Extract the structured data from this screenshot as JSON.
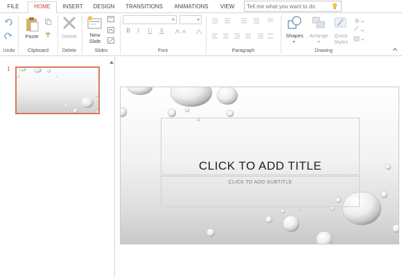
{
  "tabs": [
    {
      "label": "FILE"
    },
    {
      "label": "HOME"
    },
    {
      "label": "INSERT"
    },
    {
      "label": "DESIGN"
    },
    {
      "label": "TRANSITIONS"
    },
    {
      "label": "ANIMATIONS"
    },
    {
      "label": "VIEW"
    }
  ],
  "tellme": {
    "placeholder": "Tell me what you want to do",
    "icon": "lightbulb-icon"
  },
  "ribbon": {
    "groups": {
      "undo": "Undo",
      "clipboard": "Clipboard",
      "delete": "Delete",
      "slides": "Slides",
      "font": "Font",
      "paragraph": "Paragraph",
      "drawing": "Drawing"
    },
    "buttons": {
      "paste": "Paste",
      "delete": "Delete",
      "new_slide_1": "New",
      "new_slide_2": "Slide",
      "shapes": "Shapes",
      "arrange": "Arrange",
      "quick_styles_1": "Quick",
      "quick_styles_2": "Styles"
    },
    "format_glyphs": {
      "bold": "B",
      "italic": "I",
      "underline": "U",
      "font_color": "A"
    }
  },
  "colors": {
    "accent": "#c4492b",
    "thumb_border": "#d9775a"
  },
  "thumbnails": [
    {
      "number": "1"
    }
  ],
  "slide": {
    "title": "CLICK TO ADD TITLE",
    "subtitle": "CLICK TO ADD SUBTITLE"
  }
}
